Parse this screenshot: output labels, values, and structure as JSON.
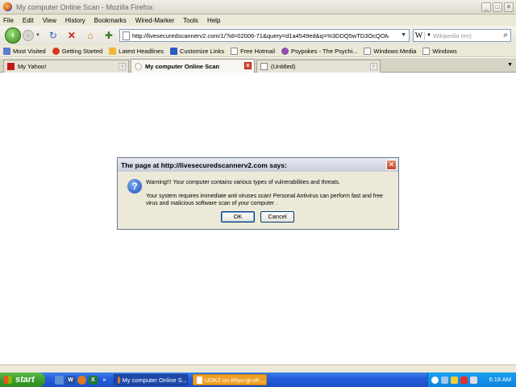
{
  "window": {
    "title": "My computer Online Scan - Mozilla Firefox",
    "buttons": {
      "minimize": "_",
      "maximize": "□",
      "close": "✕"
    }
  },
  "menu": [
    "File",
    "Edit",
    "View",
    "History",
    "Bookmarks",
    "Wired-Marker",
    "Tools",
    "Help"
  ],
  "navbar": {
    "url": "http://livesecuredscannerv2.com/1/?id=02006-71&query=d1a4549ed&q=%3DDQ5wTD3OcQOMI%3DM",
    "search_placeholder": "Wikipedia (en)",
    "search_engine": "W"
  },
  "bookmarks": [
    {
      "label": "Most Visited",
      "color": "#5a7bd0"
    },
    {
      "label": "Getting Started",
      "color": "#d23a1e"
    },
    {
      "label": "Latest Headlines",
      "color": "#f0b63a"
    },
    {
      "label": "Customize Links",
      "color": "#2a5bc6"
    },
    {
      "label": "Free Hotmail",
      "color": "#ffffff"
    },
    {
      "label": "Psypokes - The Psychi...",
      "color": "#8a4fb0"
    },
    {
      "label": "Windows Media",
      "color": "#ffffff"
    },
    {
      "label": "Windows",
      "color": "#ffffff"
    }
  ],
  "tabs": [
    {
      "label": "My Yahoo!",
      "active": false
    },
    {
      "label": "My computer Online Scan",
      "active": true
    },
    {
      "label": "(Untitled)",
      "active": false
    }
  ],
  "dialog": {
    "title": "The page at http://livesecuredscannerv2.com says:",
    "message1": "Warning!!! Your computer contains various types of vulnerabilities and threats.",
    "message2": "Your system requires immediate anti viruses scan! Personal Antivirus can perform fast and free virus and malicious software scan of your computer .",
    "ok": "OK",
    "cancel": "Cancel"
  },
  "taskbar": {
    "start": "start",
    "tasks": [
      {
        "label": "My computer Online S..."
      },
      {
        "label": "UDK2 on ##yu-gi-oh ..."
      }
    ],
    "clock": "6:18 AM"
  }
}
